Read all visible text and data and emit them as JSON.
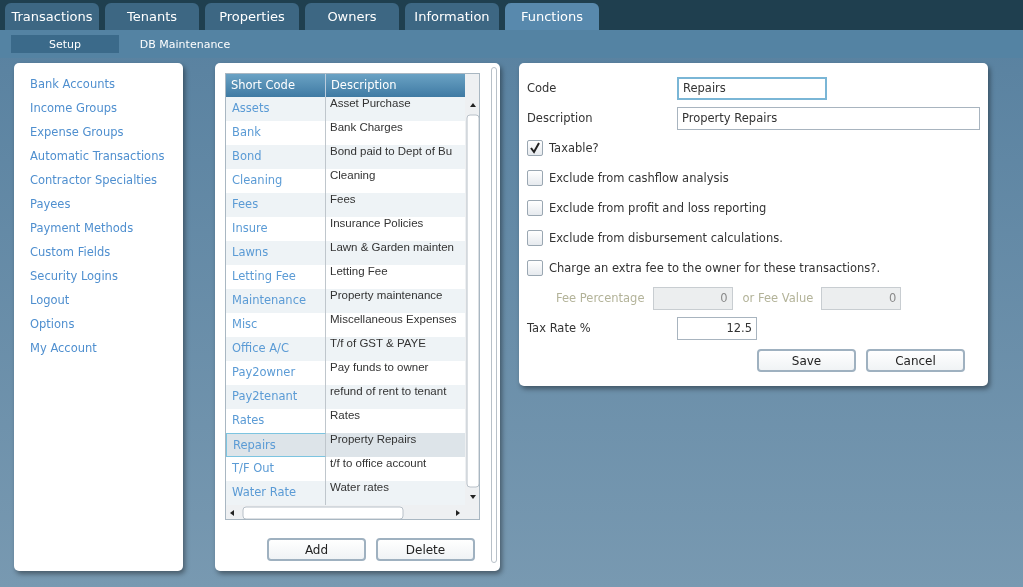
{
  "tabs": [
    {
      "label": "Transactions",
      "selected": false
    },
    {
      "label": "Tenants",
      "selected": false
    },
    {
      "label": "Properties",
      "selected": false
    },
    {
      "label": "Owners",
      "selected": false
    },
    {
      "label": "Information",
      "selected": false
    },
    {
      "label": "Functions",
      "selected": true
    }
  ],
  "subtabs": [
    {
      "label": "Setup",
      "selected": true
    },
    {
      "label": "DB Maintenance",
      "selected": false
    }
  ],
  "sidebar": {
    "items": [
      "Bank Accounts",
      "Income Groups",
      "Expense Groups",
      "Automatic Transactions",
      "Contractor Specialties",
      "Payees",
      "Payment Methods",
      "Custom Fields",
      "Security Logins",
      "Logout",
      "Options",
      "My Account"
    ]
  },
  "table": {
    "columns": [
      "Short Code",
      "Description"
    ],
    "rows": [
      {
        "code": "Assets",
        "description": "Asset Purchase",
        "selected": false
      },
      {
        "code": "Bank",
        "description": "Bank Charges",
        "selected": false
      },
      {
        "code": "Bond",
        "description": "Bond paid to Dept of Bu",
        "selected": false
      },
      {
        "code": "Cleaning",
        "description": "Cleaning",
        "selected": false
      },
      {
        "code": "Fees",
        "description": "Fees",
        "selected": false
      },
      {
        "code": "Insure",
        "description": "Insurance Policies",
        "selected": false
      },
      {
        "code": "Lawns",
        "description": "Lawn & Garden mainten",
        "selected": false
      },
      {
        "code": "Letting Fee",
        "description": "Letting Fee",
        "selected": false
      },
      {
        "code": "Maintenance",
        "description": "Property maintenance",
        "selected": false
      },
      {
        "code": "Misc",
        "description": "Miscellaneous Expenses",
        "selected": false
      },
      {
        "code": "Office A/C",
        "description": "T/f of GST & PAYE",
        "selected": false
      },
      {
        "code": "Pay2owner",
        "description": "Pay funds to owner",
        "selected": false
      },
      {
        "code": "Pay2tenant",
        "description": "refund of rent to tenant",
        "selected": false
      },
      {
        "code": "Rates",
        "description": "Rates",
        "selected": false
      },
      {
        "code": "Repairs",
        "description": "Property Repairs",
        "selected": true
      },
      {
        "code": "T/F Out",
        "description": "t/f to office account",
        "selected": false
      },
      {
        "code": "Water Rate",
        "description": "Water rates",
        "selected": false
      }
    ],
    "buttons": [
      "Add",
      "Delete"
    ]
  },
  "form": {
    "code": {
      "label": "Code",
      "value": "Repairs",
      "focused": true
    },
    "description": {
      "label": "Description",
      "value": "Property Repairs"
    },
    "checkboxes": [
      {
        "label": "Taxable?",
        "checked": true
      },
      {
        "label": "Exclude from cashflow analysis",
        "checked": false
      },
      {
        "label": "Exclude from profit and loss reporting",
        "checked": false
      },
      {
        "label": "Exclude from disbursement calculations.",
        "checked": false
      },
      {
        "label": "Charge an extra fee to the owner for these transactions?.",
        "checked": false
      }
    ],
    "fee": {
      "disabled": true,
      "percentage_label": "Fee Percentage",
      "percentage_value": "0",
      "value_label": "or Fee Value",
      "value": "0"
    },
    "tax_rate": {
      "label": "Tax Rate %",
      "value": "12.5"
    },
    "buttons": [
      "Save",
      "Cancel"
    ]
  }
}
